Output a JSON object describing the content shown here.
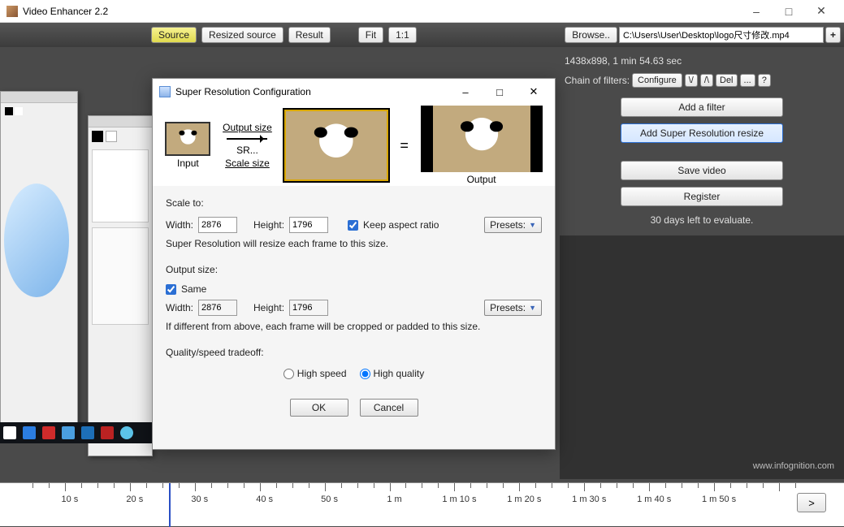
{
  "app": {
    "title": "Video Enhancer 2.2"
  },
  "toolbar": {
    "source": "Source",
    "resized": "Resized source",
    "result": "Result",
    "fit": "Fit",
    "oneone": "1:1",
    "browse": "Browse..",
    "plus": "+",
    "path": "C:\\Users\\User\\Desktop\\logo尺寸修改.mp4"
  },
  "side": {
    "info": "1438x898, 1 min 54.63 sec",
    "chain_label": "Chain of filters:",
    "configure": "Configure",
    "up": "\\/",
    "down": "/\\",
    "del": "Del",
    "dots": "...",
    "help": "?",
    "add_filter": "Add a filter",
    "add_sr": "Add Super Resolution resize",
    "save": "Save video",
    "register": "Register",
    "trial": "30 days left to evaluate."
  },
  "dialog": {
    "title": "Super Resolution Configuration",
    "illus": {
      "input": "Input",
      "output_size": "Output size",
      "scale_size": "Scale size",
      "sr": "SR...",
      "output": "Output",
      "eq": "="
    },
    "scale_to": "Scale to:",
    "width_l": "Width:",
    "height_l": "Height:",
    "scale_w": "2876",
    "scale_h": "1796",
    "keep_ar": "Keep aspect ratio",
    "presets": "Presets:",
    "scale_hint": "Super Resolution will resize each frame to this size.",
    "output_size_t": "Output size:",
    "same": "Same",
    "out_w": "2876",
    "out_h": "1796",
    "out_hint": "If different from above, each frame will be cropped or padded to this size.",
    "quality_t": "Quality/speed tradeoff:",
    "high_speed": "High speed",
    "high_quality": "High quality",
    "ok": "OK",
    "cancel": "Cancel"
  },
  "footer": {
    "url": "www.infognition.com"
  },
  "timeline": {
    "ticks": [
      "10 s",
      "20 s",
      "30 s",
      "40 s",
      "50 s",
      "1 m",
      "1 m 10 s",
      "1 m 20 s",
      "1 m 30 s",
      "1 m 40 s",
      "1 m 50 s"
    ],
    "go": ">"
  }
}
